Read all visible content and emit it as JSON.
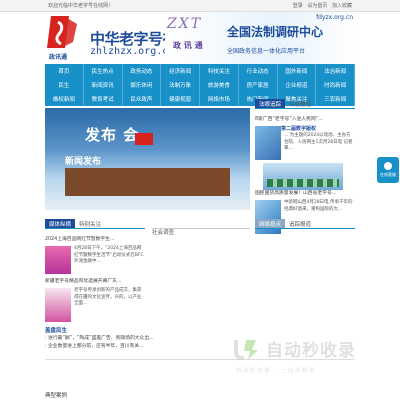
{
  "topbar": {
    "welcome": "欢迎光临中华老字号在线网！",
    "links": [
      "登录",
      "设为首页",
      "加入收藏"
    ]
  },
  "header": {
    "logo_sub": "政讯通",
    "site_name": "中华老字号在线网",
    "site_domain": "zhlzhzx.org.cn",
    "banner": {
      "zxt": "ZXT",
      "logo_text": "政 讯 通",
      "url": "fdyzx.org.cn",
      "title": "全国法制调研中心",
      "subtitle": "全国政务信息一体化应用平台"
    }
  },
  "nav": {
    "items": [
      "首页",
      "民生热点",
      "政务动态",
      "经济新闻",
      "科技关注",
      "行业动态",
      "国外新闻",
      "法治新闻",
      "民生",
      "新闻资讯",
      "娱乐休闲",
      "法制万象",
      "旅游美食",
      "房产家居",
      "企业频道",
      "时尚新闻",
      "维权新闻",
      "教育考试",
      "民众政声",
      "健康视窗",
      "网络市场",
      "热门新闻",
      "聚焦关注",
      "三农新闻"
    ]
  },
  "hero": {
    "title": "发布 会",
    "caption": "新闻发布"
  },
  "right_panel": {
    "tabs": [
      "法眼追踪",
      "深度报道"
    ],
    "first_item": "8家广西“老字号”入驻人民网“...",
    "block1_head": "第二届数字版权",
    "block1_text": "... 为主题的2024以现场、主办方合院、人民网主1次月28日电 记者覃...",
    "mid_item": "国民国货高质量发展！山西省老字号...",
    "block2_text": "中新网山西4月28日电 传承千年的经典好酒来，重构国际的大..."
  },
  "float_button": {
    "label": "在线客服"
  },
  "middle_left": {
    "tabs": [
      "媒体纵横",
      "特别关注"
    ],
    "first_item": "2024上海百品网红节暨数字生...",
    "block1_text": "4月28日下午，“2024上海百品网红节暨数字生活节”启动仪式在BFC外滩金融中...",
    "mid_item": "新疆老字号精品和优选展开幕广东...",
    "block2_text": "老字号传承创新的产品成交，集获得在疆的文化宣传，兴的，以产业全面..."
  },
  "middle_center": {
    "title": "社会调查"
  },
  "middle_right": {
    "tabs": [
      "网络视点",
      "追踪报道"
    ]
  },
  "bottom_list": {
    "head": "盖盘民生",
    "items": [
      "· 进行最“酬”，“陶成”盛差广告、到随场的大众出...",
      "· 企业数量进上都分前，还有半年，百川有关..."
    ]
  },
  "bottom_tab": "典型案例",
  "watermark": {
    "text": "自动秒收录",
    "sub": "自动秒收录 · 一站式收录"
  },
  "colors": {
    "nav_bg": "#1891c9",
    "brand_blue": "#1d4c9b",
    "logo_red": "#d8231f"
  }
}
